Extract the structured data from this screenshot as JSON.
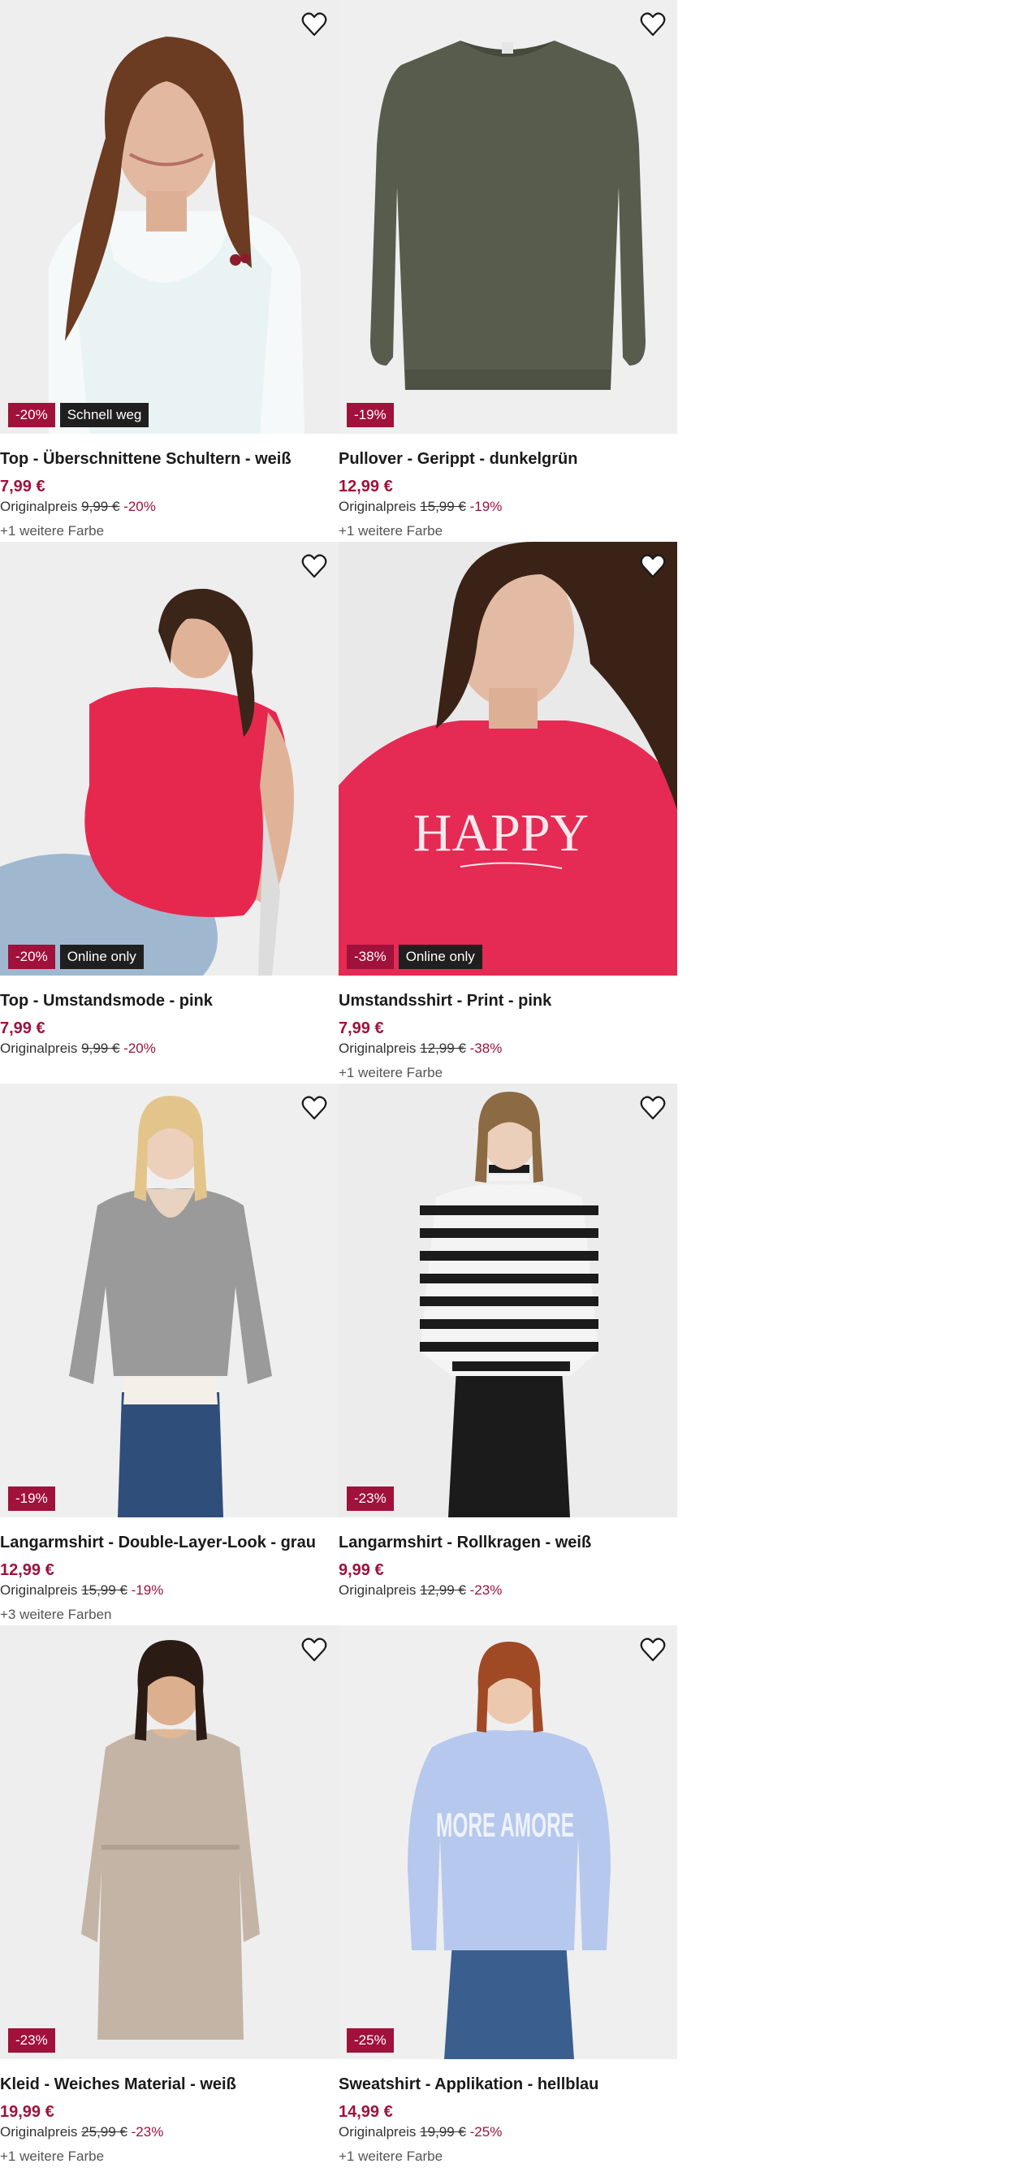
{
  "colors": {
    "accent": "#a0113b",
    "label_badge": "#1f1f1f",
    "image_bg": "#f0f0f0"
  },
  "products": [
    {
      "title": "Top - Überschnittene Schultern - weiß",
      "price": "7,99 €",
      "original_label": "Originalpreis",
      "original_price": "9,99 €",
      "discount": "-20%",
      "label": "Schnell weg",
      "more_colors": "+1 weitere Farbe",
      "image": "woman-white-tank-top"
    },
    {
      "title": "Pullover - Gerippt - dunkelgrün",
      "price": "12,99 €",
      "original_label": "Originalpreis",
      "original_price": "15,99 €",
      "discount": "-19%",
      "label": "",
      "more_colors": "+1 weitere Farbe",
      "image": "dark-green-pullover"
    },
    {
      "title": "Top - Umstandsmode - pink",
      "price": "7,99 €",
      "original_label": "Originalpreis",
      "original_price": "9,99 €",
      "discount": "-20%",
      "label": "Online only",
      "more_colors": "",
      "image": "pregnant-woman-pink-top"
    },
    {
      "title": "Umstandsshirt - Print - pink",
      "price": "7,99 €",
      "original_label": "Originalpreis",
      "original_price": "12,99 €",
      "discount": "-38%",
      "label": "Online only",
      "more_colors": "+1 weitere Farbe",
      "image": "woman-pink-happy-shirt",
      "print_text": "HAPPY"
    },
    {
      "title": "Langarmshirt - Double-Layer-Look - grau",
      "price": "12,99 €",
      "original_label": "Originalpreis",
      "original_price": "15,99 €",
      "discount": "-19%",
      "label": "",
      "more_colors": "+3 weitere Farben",
      "image": "woman-grey-cardigan"
    },
    {
      "title": "Langarmshirt - Rollkragen - weiß",
      "price": "9,99 €",
      "original_label": "Originalpreis",
      "original_price": "12,99 €",
      "discount": "-23%",
      "label": "",
      "more_colors": "",
      "image": "woman-striped-turtleneck"
    },
    {
      "title": "Kleid - Weiches Material - weiß",
      "price": "19,99 €",
      "original_label": "Originalpreis",
      "original_price": "25,99 €",
      "discount": "-23%",
      "label": "",
      "more_colors": "+1 weitere Farbe",
      "image": "woman-beige-dress"
    },
    {
      "title": "Sweatshirt - Applikation - hellblau",
      "price": "14,99 €",
      "original_label": "Originalpreis",
      "original_price": "19,99 €",
      "discount": "-25%",
      "label": "",
      "more_colors": "+1 weitere Farbe",
      "image": "woman-light-blue-sweatshirt",
      "print_text": "MORE AMORE"
    }
  ]
}
